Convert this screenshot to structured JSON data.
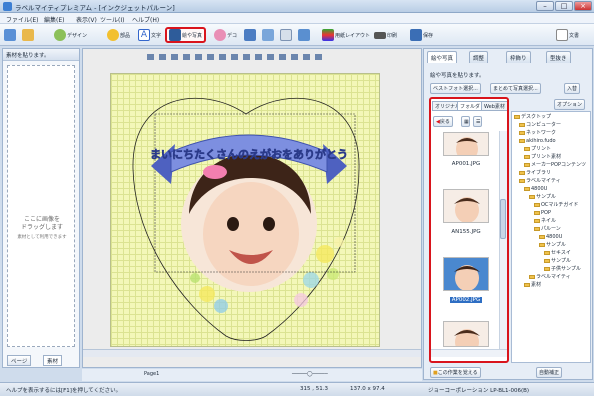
{
  "window": {
    "title": "ラベルマイティプレミアム - [インクジェットパルーン]"
  },
  "menu": [
    "ファイル(E)",
    "編集(E)",
    "表示(V)",
    "ツール(I)",
    "ヘルプ(H)"
  ],
  "toolbar": {
    "design": "デザイン",
    "parts": "部品",
    "text": "文字",
    "photo": "絵や写真",
    "deco": "デコ",
    "layout": "用紙レイアウト",
    "print": "印刷",
    "save": "保存",
    "doc": "文書"
  },
  "left_panel": {
    "header": "素材を貼ります。",
    "drop_text_1": "ここに画像を",
    "drop_text_2": "ドラッグします",
    "drop_hint": "素材として利用できます",
    "page_button": "ページ",
    "material_button": "素材"
  },
  "canvas": {
    "banner_text": "まいにちたくさんのえがおをありがとう",
    "page_label": "Page1",
    "position": "315 , 51.3",
    "size": "137.0 x 97.4"
  },
  "right_panel": {
    "tabs": [
      "絵や写真",
      "調整",
      "枠飾り",
      "型抜き"
    ],
    "description": "絵や写真を貼ります。",
    "best_photo_button": "ベストフォト選択...",
    "batch_button": "まとめて写真選択...",
    "import_button": "入替",
    "subtabs": [
      "オリジナル",
      "フォルダ",
      "Web素材",
      "スキャナ",
      "額"
    ],
    "back_button": "戻る",
    "option_button": "オプション",
    "files": [
      "AP001.JPG",
      "AN155.JPG",
      "AP002.JPG"
    ],
    "tree": [
      "デスクトップ",
      "コンピューター",
      "ネットワーク",
      "akihiro.fudo",
      "プリント",
      "プリント素材",
      "メーカーPOPコンテンツ",
      "ライブラリ",
      "ラベルマイティ",
      "4800U",
      "サンプル",
      "OCマルチガイド",
      "POP",
      "ネイル",
      "パルーン",
      "4800U",
      "サンプル",
      "セキスイ",
      "サンプル",
      "子供サンプル",
      "ラベルマイティ",
      "素材"
    ],
    "use_folder_button": "この作業を覚える",
    "auto_adjust_button": "自動補正"
  },
  "status": {
    "help": "ヘルプを表示するには[F1]を押してください。",
    "company": "ジョーコーポレーション LP-BL1-006(B)"
  },
  "colors": {
    "highlight": "#d9141c",
    "paper": "#f3f7b8",
    "banner": "#6e7fd4"
  }
}
